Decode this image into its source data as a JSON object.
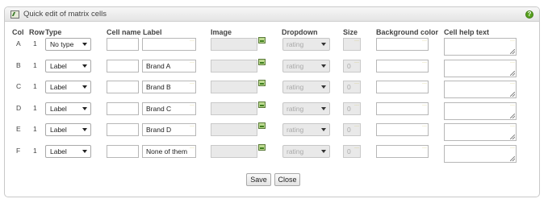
{
  "panel": {
    "title": "Quick edit of matrix cells"
  },
  "headers": {
    "col": "Col",
    "row": "Row",
    "type": "Type",
    "cell_name": "Cell name",
    "label": "Label",
    "image": "Image",
    "dropdown": "Dropdown",
    "size": "Size",
    "background_color": "Background color",
    "cell_help_text": "Cell help text"
  },
  "rows": [
    {
      "col": "A",
      "row": "1",
      "type": "No type",
      "cell_name": "",
      "label": "",
      "dropdown": "rating",
      "size": "",
      "background_color": "",
      "help_text": ""
    },
    {
      "col": "B",
      "row": "1",
      "type": "Label",
      "cell_name": "",
      "label": "Brand A",
      "dropdown": "rating",
      "size": "0",
      "background_color": "",
      "help_text": ""
    },
    {
      "col": "C",
      "row": "1",
      "type": "Label",
      "cell_name": "",
      "label": "Brand B",
      "dropdown": "rating",
      "size": "0",
      "background_color": "",
      "help_text": ""
    },
    {
      "col": "D",
      "row": "1",
      "type": "Label",
      "cell_name": "",
      "label": "Brand C",
      "dropdown": "rating",
      "size": "0",
      "background_color": "",
      "help_text": ""
    },
    {
      "col": "E",
      "row": "1",
      "type": "Label",
      "cell_name": "",
      "label": "Brand D",
      "dropdown": "rating",
      "size": "0",
      "background_color": "",
      "help_text": ""
    },
    {
      "col": "F",
      "row": "1",
      "type": "Label",
      "cell_name": "",
      "label": "None of them",
      "dropdown": "rating",
      "size": "0",
      "background_color": "",
      "help_text": ""
    }
  ],
  "buttons": {
    "save": "Save",
    "close": "Close"
  }
}
